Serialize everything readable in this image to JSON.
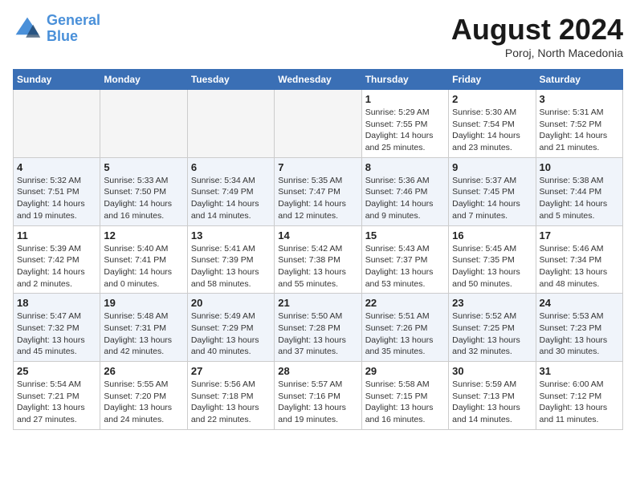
{
  "header": {
    "logo_line1": "General",
    "logo_line2": "Blue",
    "month_title": "August 2024",
    "subtitle": "Poroj, North Macedonia"
  },
  "weekdays": [
    "Sunday",
    "Monday",
    "Tuesday",
    "Wednesday",
    "Thursday",
    "Friday",
    "Saturday"
  ],
  "weeks": [
    [
      {
        "day": "",
        "empty": true
      },
      {
        "day": "",
        "empty": true
      },
      {
        "day": "",
        "empty": true
      },
      {
        "day": "",
        "empty": true
      },
      {
        "day": "1",
        "info": "Sunrise: 5:29 AM\nSunset: 7:55 PM\nDaylight: 14 hours\nand 25 minutes."
      },
      {
        "day": "2",
        "info": "Sunrise: 5:30 AM\nSunset: 7:54 PM\nDaylight: 14 hours\nand 23 minutes."
      },
      {
        "day": "3",
        "info": "Sunrise: 5:31 AM\nSunset: 7:52 PM\nDaylight: 14 hours\nand 21 minutes."
      }
    ],
    [
      {
        "day": "4",
        "info": "Sunrise: 5:32 AM\nSunset: 7:51 PM\nDaylight: 14 hours\nand 19 minutes."
      },
      {
        "day": "5",
        "info": "Sunrise: 5:33 AM\nSunset: 7:50 PM\nDaylight: 14 hours\nand 16 minutes."
      },
      {
        "day": "6",
        "info": "Sunrise: 5:34 AM\nSunset: 7:49 PM\nDaylight: 14 hours\nand 14 minutes."
      },
      {
        "day": "7",
        "info": "Sunrise: 5:35 AM\nSunset: 7:47 PM\nDaylight: 14 hours\nand 12 minutes."
      },
      {
        "day": "8",
        "info": "Sunrise: 5:36 AM\nSunset: 7:46 PM\nDaylight: 14 hours\nand 9 minutes."
      },
      {
        "day": "9",
        "info": "Sunrise: 5:37 AM\nSunset: 7:45 PM\nDaylight: 14 hours\nand 7 minutes."
      },
      {
        "day": "10",
        "info": "Sunrise: 5:38 AM\nSunset: 7:44 PM\nDaylight: 14 hours\nand 5 minutes."
      }
    ],
    [
      {
        "day": "11",
        "info": "Sunrise: 5:39 AM\nSunset: 7:42 PM\nDaylight: 14 hours\nand 2 minutes."
      },
      {
        "day": "12",
        "info": "Sunrise: 5:40 AM\nSunset: 7:41 PM\nDaylight: 14 hours\nand 0 minutes."
      },
      {
        "day": "13",
        "info": "Sunrise: 5:41 AM\nSunset: 7:39 PM\nDaylight: 13 hours\nand 58 minutes."
      },
      {
        "day": "14",
        "info": "Sunrise: 5:42 AM\nSunset: 7:38 PM\nDaylight: 13 hours\nand 55 minutes."
      },
      {
        "day": "15",
        "info": "Sunrise: 5:43 AM\nSunset: 7:37 PM\nDaylight: 13 hours\nand 53 minutes."
      },
      {
        "day": "16",
        "info": "Sunrise: 5:45 AM\nSunset: 7:35 PM\nDaylight: 13 hours\nand 50 minutes."
      },
      {
        "day": "17",
        "info": "Sunrise: 5:46 AM\nSunset: 7:34 PM\nDaylight: 13 hours\nand 48 minutes."
      }
    ],
    [
      {
        "day": "18",
        "info": "Sunrise: 5:47 AM\nSunset: 7:32 PM\nDaylight: 13 hours\nand 45 minutes."
      },
      {
        "day": "19",
        "info": "Sunrise: 5:48 AM\nSunset: 7:31 PM\nDaylight: 13 hours\nand 42 minutes."
      },
      {
        "day": "20",
        "info": "Sunrise: 5:49 AM\nSunset: 7:29 PM\nDaylight: 13 hours\nand 40 minutes."
      },
      {
        "day": "21",
        "info": "Sunrise: 5:50 AM\nSunset: 7:28 PM\nDaylight: 13 hours\nand 37 minutes."
      },
      {
        "day": "22",
        "info": "Sunrise: 5:51 AM\nSunset: 7:26 PM\nDaylight: 13 hours\nand 35 minutes."
      },
      {
        "day": "23",
        "info": "Sunrise: 5:52 AM\nSunset: 7:25 PM\nDaylight: 13 hours\nand 32 minutes."
      },
      {
        "day": "24",
        "info": "Sunrise: 5:53 AM\nSunset: 7:23 PM\nDaylight: 13 hours\nand 30 minutes."
      }
    ],
    [
      {
        "day": "25",
        "info": "Sunrise: 5:54 AM\nSunset: 7:21 PM\nDaylight: 13 hours\nand 27 minutes."
      },
      {
        "day": "26",
        "info": "Sunrise: 5:55 AM\nSunset: 7:20 PM\nDaylight: 13 hours\nand 24 minutes."
      },
      {
        "day": "27",
        "info": "Sunrise: 5:56 AM\nSunset: 7:18 PM\nDaylight: 13 hours\nand 22 minutes."
      },
      {
        "day": "28",
        "info": "Sunrise: 5:57 AM\nSunset: 7:16 PM\nDaylight: 13 hours\nand 19 minutes."
      },
      {
        "day": "29",
        "info": "Sunrise: 5:58 AM\nSunset: 7:15 PM\nDaylight: 13 hours\nand 16 minutes."
      },
      {
        "day": "30",
        "info": "Sunrise: 5:59 AM\nSunset: 7:13 PM\nDaylight: 13 hours\nand 14 minutes."
      },
      {
        "day": "31",
        "info": "Sunrise: 6:00 AM\nSunset: 7:12 PM\nDaylight: 13 hours\nand 11 minutes."
      }
    ]
  ]
}
